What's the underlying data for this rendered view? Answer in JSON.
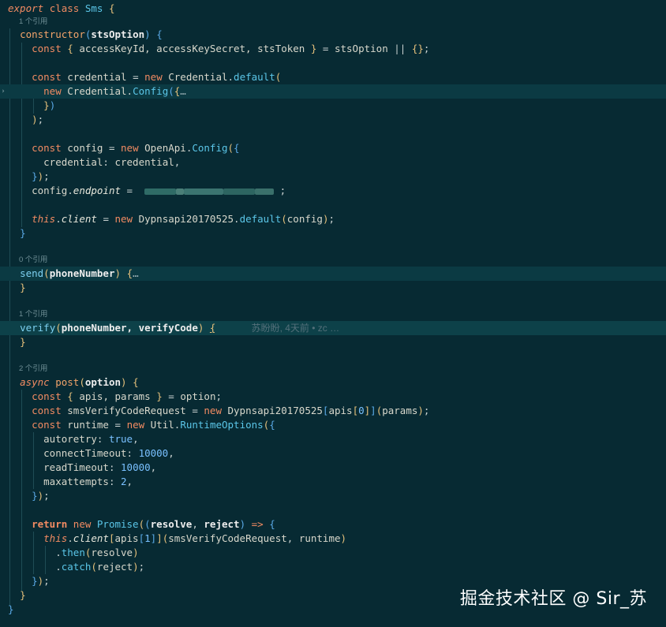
{
  "class_decl": {
    "export": "export",
    "class_kw": "class",
    "name": "Sms",
    "brace": "{"
  },
  "lenses": {
    "constructor": "1 个引用",
    "send": "0 个引用",
    "verify": "1 个引用",
    "post": "2 个引用"
  },
  "constructor": {
    "name": "constructor",
    "param": "stsOption",
    "destructure_fields": "accessKeyId, accessKeySecret, stsToken",
    "destructure_source": "stsOption",
    "fallback": "{}",
    "credential_var": "credential",
    "credential_class": "Credential",
    "default_prop": "default",
    "config_prop": "Config",
    "collapsed": "…",
    "config_var": "config",
    "openapi_class": "OpenApi",
    "credential_key": "credential",
    "endpoint_prop": "endpoint",
    "client_prop": "client",
    "client_class": "Dypnsapi20170525",
    "this_kw": "this"
  },
  "send": {
    "name": "send",
    "param": "phoneNumber",
    "collapsed": "…"
  },
  "verify": {
    "name": "verify",
    "params": "phoneNumber, verifyCode",
    "blame": "苏盼盼, 4天前 • zc …"
  },
  "post": {
    "async_kw": "async",
    "name": "post",
    "param": "option",
    "destructure_fields": "apis, params",
    "request_var": "smsVerifyCodeRequest",
    "request_class": "Dypnsapi20170525",
    "apis_index0": "0",
    "params_arg": "params",
    "runtime_var": "runtime",
    "util_class": "Util",
    "runtime_options": "RuntimeOptions",
    "options": [
      {
        "key": "autoretry",
        "value": "true"
      },
      {
        "key": "connectTimeout",
        "value": "10000"
      },
      {
        "key": "readTimeout",
        "value": "10000"
      },
      {
        "key": "maxattempts",
        "value": "2"
      }
    ],
    "return_kw": "return",
    "promise_class": "Promise",
    "resolve": "resolve",
    "reject": "reject",
    "apis_index1": "1",
    "then_fn": "then",
    "catch_fn": "catch"
  },
  "watermark": "掘金技术社区 @ Sir_苏",
  "colors": {
    "background": "#072a33",
    "keyword": "#f28b62",
    "class": "#5bc6e8",
    "number": "#79c0ff",
    "bracket": "#e5c07b"
  }
}
